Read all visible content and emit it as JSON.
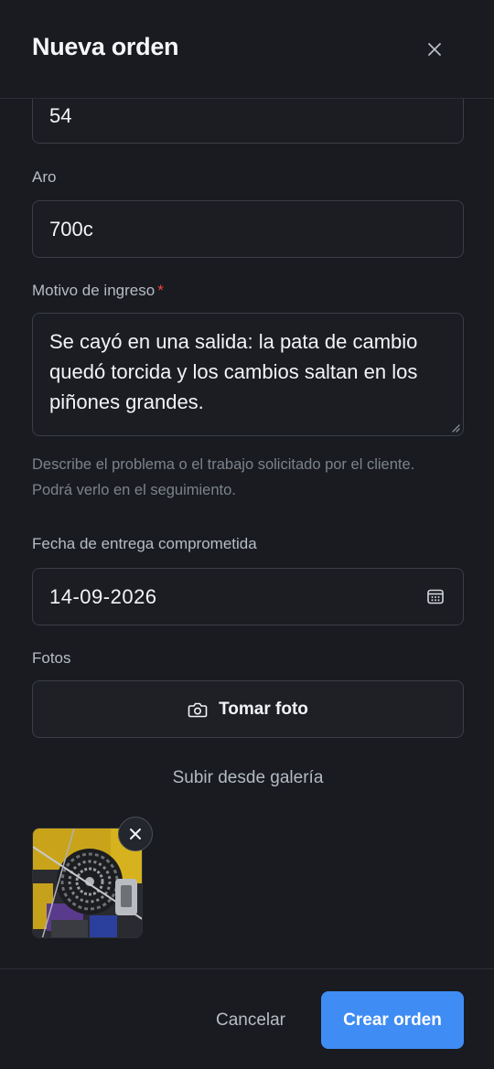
{
  "header": {
    "title": "Nueva orden",
    "close_icon": "close-icon"
  },
  "form": {
    "size_value": "54",
    "rim": {
      "label": "Aro",
      "value": "700c"
    },
    "reason": {
      "label": "Motivo de ingreso",
      "required_mark": "*",
      "value": "Se cayó en una salida: la pata de cambio quedó torcida y los cambios saltan en los piñones grandes.",
      "help": "Describe el problema o el trabajo solicitado por el cliente. Podrá verlo en el seguimiento."
    },
    "delivery_date": {
      "label": "Fecha de entrega comprometida",
      "value": "14-09-2026",
      "icon": "calendar-icon"
    },
    "photos": {
      "label": "Fotos",
      "take_photo_label": "Tomar foto",
      "take_photo_icon": "camera-icon",
      "gallery_label": "Subir desde galería",
      "thumbnail_count": 1
    }
  },
  "footer": {
    "cancel_label": "Cancelar",
    "submit_label": "Crear orden"
  },
  "colors": {
    "background": "#191b20",
    "accent": "#3f8cf4",
    "required": "#ef4444"
  }
}
